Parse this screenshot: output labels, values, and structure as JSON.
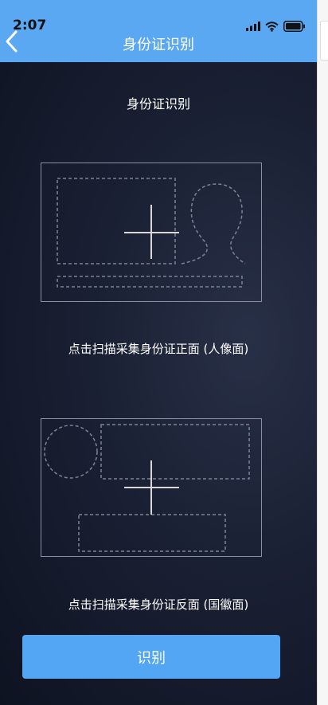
{
  "status_bar": {
    "time": "2:07"
  },
  "nav": {
    "title": "身份证识别",
    "back_icon": "chevron-left-icon"
  },
  "page": {
    "section_title": "身份证识别"
  },
  "front_card": {
    "caption": "点击扫描采集身份证正面 (人像面)",
    "icon": "plus-icon"
  },
  "back_card": {
    "caption": "点击扫描采集身份证反面 (国徽面)",
    "icon": "plus-icon"
  },
  "recognize_button": {
    "label": "识别"
  },
  "colors": {
    "accent": "#52a6f3",
    "nav_bar": "#5aa8f2",
    "background": "#141a2b",
    "outline": "#8a90a2"
  }
}
